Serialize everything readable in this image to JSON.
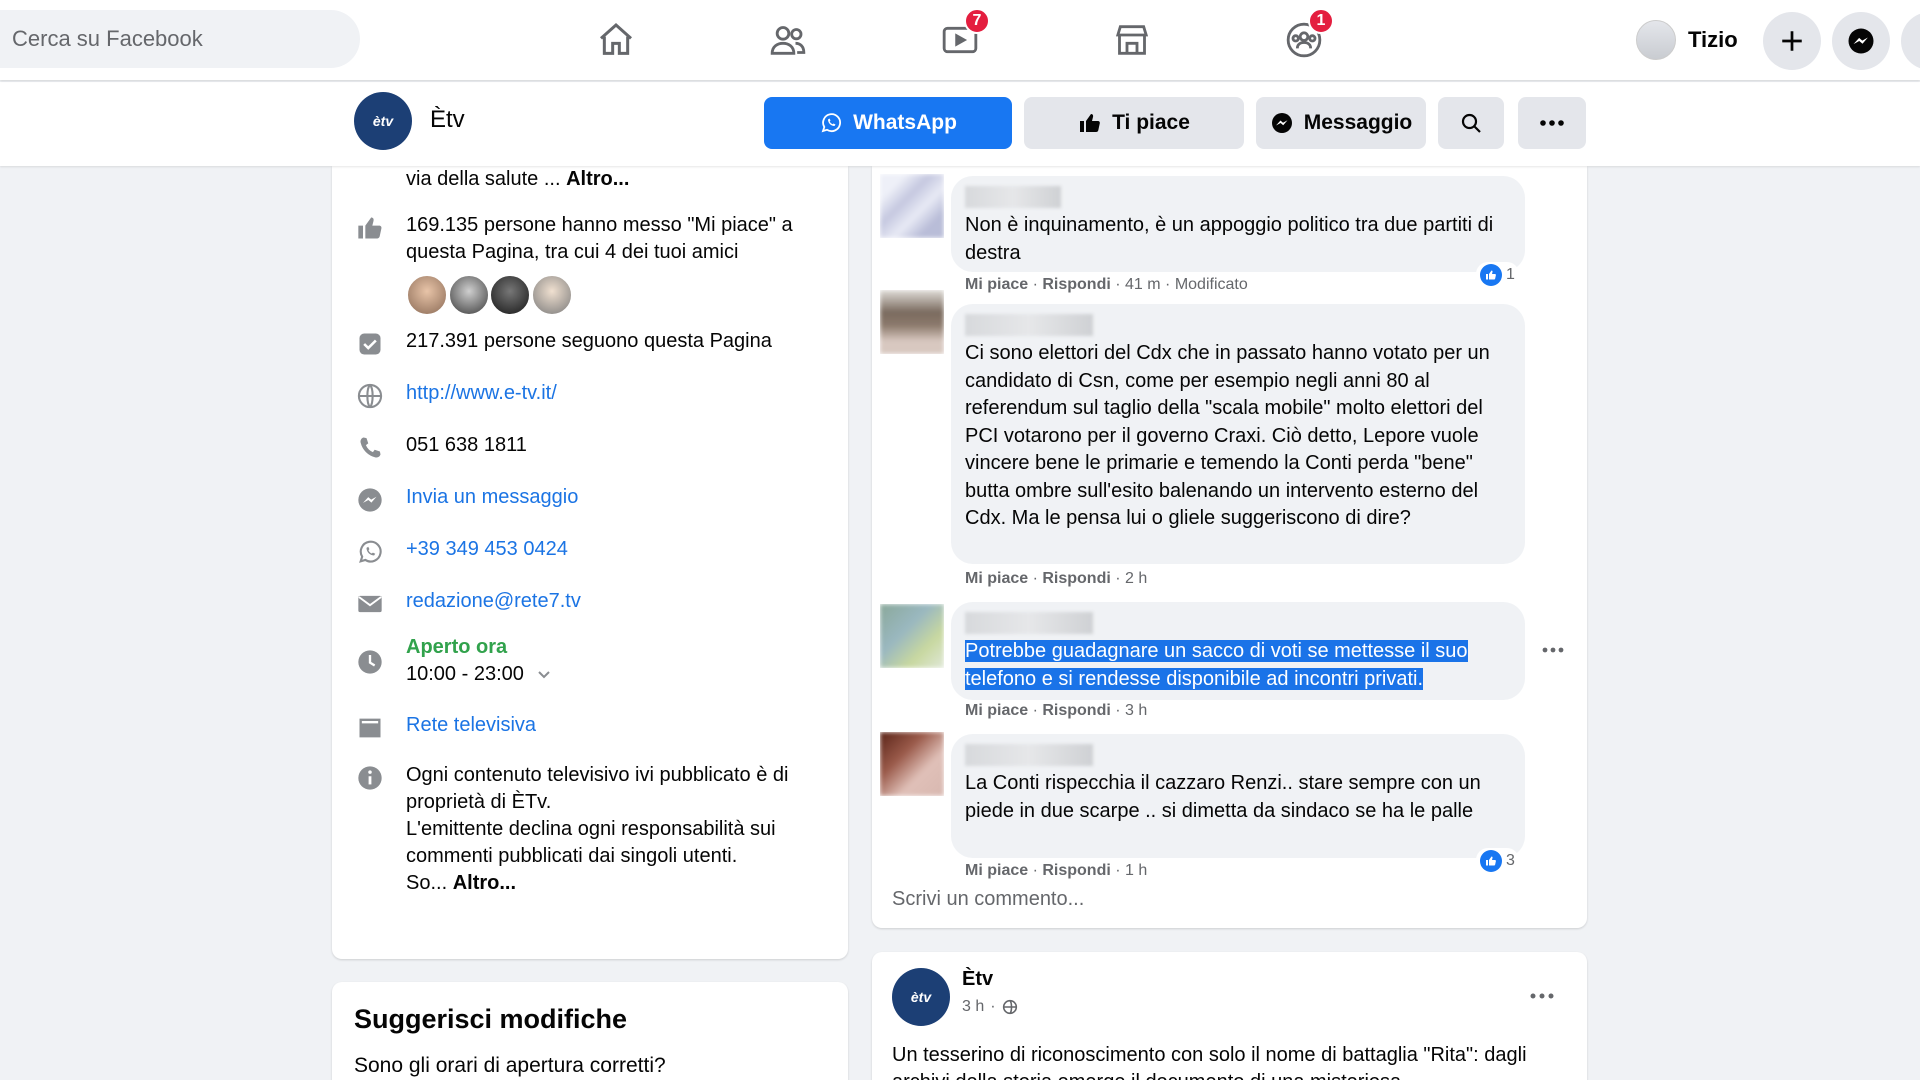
{
  "topbar": {
    "search_placeholder": "Cerca su Facebook",
    "nav": [
      {
        "icon": "home-icon"
      },
      {
        "icon": "friends-icon"
      },
      {
        "icon": "watch-icon",
        "badge": "7"
      },
      {
        "icon": "marketplace-icon"
      },
      {
        "icon": "groups-icon",
        "badge": "1"
      }
    ],
    "user_name": "Tizio"
  },
  "page_header": {
    "logo_text": "ètv",
    "page_name": "Ètv",
    "whatsapp_label": "WhatsApp",
    "like_label": "Ti piace",
    "message_label": "Messaggio"
  },
  "about": {
    "intro_tail": "via della salute ... ",
    "intro_more": "Altro...",
    "likes_text": "169.135 persone hanno messo \"Mi piace\" a questa Pagina, tra cui 4 dei tuoi amici",
    "followers_text": "217.391 persone seguono questa Pagina",
    "website": "http://www.e-tv.it/",
    "phone": "051 638 1811",
    "send_message": "Invia un messaggio",
    "whatsapp_number": "+39 349 453 0424",
    "email": "redazione@rete7.tv",
    "open_status": "Aperto ora",
    "hours": "10:00 - 23:00",
    "category": "Rete televisiva",
    "description_text": "Ogni contenuto televisivo ivi pubblicato è di proprietà di ÈTv.\nL'emittente declina ogni responsabilità sui commenti pubblicati dai singoli utenti.\nSo... ",
    "description_more": "Altro..."
  },
  "suggest": {
    "title": "Suggerisci modifiche",
    "question": "Sono gli orari di apertura corretti?"
  },
  "comments": [
    {
      "text": "Non è inquinamento, è un appoggio politico tra due partiti di destra",
      "like": "Mi piace",
      "reply": "Rispondi",
      "time": "41 m",
      "edited": "Modificato",
      "reactions": "1"
    },
    {
      "text": "Ci sono elettori del Cdx che in passato hanno votato per un candidato di Csn, come per esempio negli anni 80 al referendum sul taglio della \"scala mobile\" molto elettori del PCI votarono per il governo Craxi. Ciò detto, Lepore vuole vincere bene le primarie e temendo la Conti perda \"bene\" butta ombre sull'esito balenando un intervento esterno del Cdx. Ma le pensa lui o gliele suggeriscono di dire?",
      "like": "Mi piace",
      "reply": "Rispondi",
      "time": "2 h"
    },
    {
      "text": "Potrebbe guadagnare un sacco di voti se mettesse il suo telefono e si rendesse disponibile ad incontri privati.",
      "like": "Mi piace",
      "reply": "Rispondi",
      "time": "3 h"
    },
    {
      "text": "La Conti rispecchia il cazzaro Renzi.. stare sempre con un piede in due scarpe .. si dimetta da sindaco se ha le palle",
      "like": "Mi piace",
      "reply": "Rispondi",
      "time": "1 h",
      "reactions": "3"
    }
  ],
  "write_comment": "Scrivi un commento...",
  "next_post": {
    "author": "Ètv",
    "time": "3 h",
    "text": "Un tesserino di riconoscimento con solo il nome di battaglia \"Rita\": dagli archivi della storia emerge il documento di una misteriosa"
  },
  "colors": {
    "brand": "#1877f2",
    "badge": "#e41e3f",
    "open_green": "#31a24c",
    "selection": "#1a73e8"
  }
}
